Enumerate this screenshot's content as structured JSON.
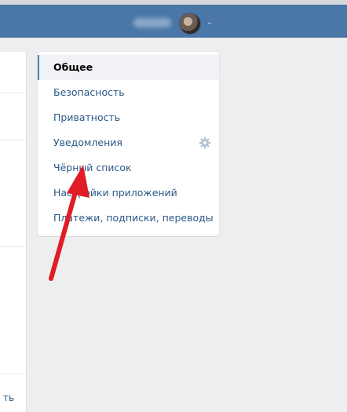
{
  "menu": {
    "items": [
      {
        "label": "Общее",
        "selected": true
      },
      {
        "label": "Безопасность",
        "selected": false
      },
      {
        "label": "Приватность",
        "selected": false
      },
      {
        "label": "Уведомления",
        "selected": false,
        "icon": "gear-icon"
      },
      {
        "label": "Чёрный список",
        "selected": false
      },
      {
        "label": "Настройки приложений",
        "selected": false
      },
      {
        "label": "Платежи, подписки, переводы",
        "selected": false
      }
    ]
  },
  "left_panel": {
    "cut_text": "ть"
  },
  "colors": {
    "header": "#4a76a8",
    "background": "#edeef0",
    "link": "#2a5885",
    "selected_bg": "#f0f2f5",
    "arrow": "#e01d26"
  }
}
